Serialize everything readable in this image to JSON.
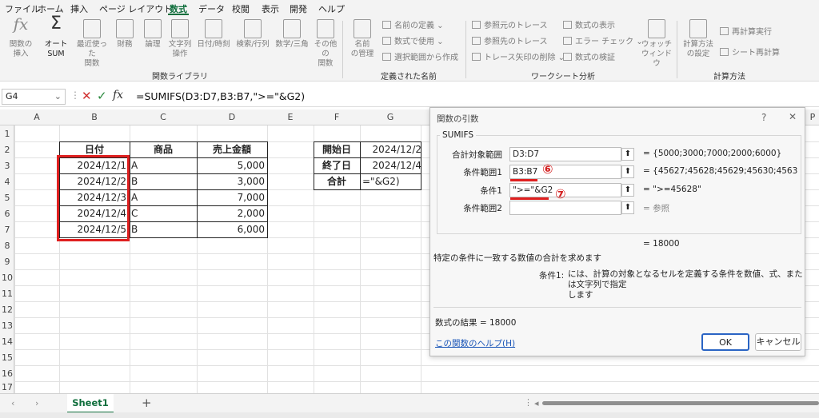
{
  "tabs": [
    "ファイル",
    "ホーム",
    "挿入",
    "ページ レイアウト",
    "数式",
    "データ",
    "校閲",
    "表示",
    "開発",
    "ヘルプ"
  ],
  "active_tab": "数式",
  "ribbon": {
    "fx_label": "関数の\n挿入",
    "autosum_label": "オート\nSUM",
    "recent_label": "最近使った\n関数",
    "finance_label": "財務",
    "logic_label": "論理",
    "text_label": "文字列\n操作",
    "datetime_label": "日付/時刻",
    "lookup_label": "検索/行列",
    "math_label": "数学/三角",
    "other_label": "その他の\n関数",
    "library_group": "関数ライブラリ",
    "name_mgr_label": "名前\nの管理",
    "define_name": "名前の定義",
    "use_in_formula": "数式で使用",
    "create_from_sel": "選択範囲から作成",
    "defined_names_group": "定義された名前",
    "trace_precedents": "参照元のトレース",
    "trace_dependents": "参照先のトレース",
    "remove_arrows": "トレース矢印の削除",
    "show_formulas": "数式の表示",
    "error_check": "エラー チェック",
    "evaluate_formula": "数式の検証",
    "watch_window": "ウォッチ\nウィンドウ",
    "auditing_group": "ワークシート分析",
    "calc_options": "計算方法\nの設定",
    "calc_now": "再計算実行",
    "calc_sheet": "シート再計算",
    "calc_group": "計算方法"
  },
  "formula_bar": {
    "name_box": "G4",
    "formula": "=SUMIFS(D3:D7,B3:B7,\">=\"&G2)"
  },
  "columns": [
    "A",
    "B",
    "C",
    "D",
    "E",
    "F",
    "G",
    "P"
  ],
  "rows": [
    "1",
    "2",
    "3",
    "4",
    "5",
    "6",
    "7",
    "8",
    "9",
    "10",
    "11",
    "12",
    "13",
    "14",
    "15",
    "16",
    "17"
  ],
  "table": {
    "headers": [
      "日付",
      "商品",
      "売上金額"
    ],
    "rows": [
      [
        "2024/12/1",
        "A",
        "5,000"
      ],
      [
        "2024/12/2",
        "B",
        "3,000"
      ],
      [
        "2024/12/3",
        "A",
        "7,000"
      ],
      [
        "2024/12/4",
        "C",
        "2,000"
      ],
      [
        "2024/12/5",
        "B",
        "6,000"
      ]
    ]
  },
  "side_table": {
    "start_label": "開始日",
    "start_value": "2024/12/2",
    "end_label": "終了日",
    "end_value": "2024/12/4",
    "total_label": "合計",
    "total_value": "=\"&G2)"
  },
  "dialog": {
    "title": "関数の引数",
    "help_q": "?",
    "close": "✕",
    "func_name": "SUMIFS",
    "arg1_label": "合計対象範囲",
    "arg1_value": "D3:D7",
    "arg1_result": "= {5000;3000;7000;2000;6000}",
    "arg2_label": "条件範囲1",
    "arg2_value": "B3:B7",
    "arg2_result": "= {45627;45628;45629;45630;4563",
    "arg3_label": "条件1",
    "arg3_value": "\">=\"&G2",
    "arg3_result": "= \">=45628\"",
    "arg4_label": "条件範囲2",
    "arg4_value": "",
    "arg4_result": "= 参照",
    "marker6": "⑥",
    "marker7": "⑦",
    "result_line": "=  18000",
    "description": "特定の条件に一致する数値の合計を求めます",
    "cond_label": "条件1:",
    "cond_help": "には、計算の対象となるセルを定義する条件を数値、式、または文字列で指定\nします",
    "formula_result": "数式の結果 =   18000",
    "help_link": "この関数のヘルプ(H)",
    "ok": "OK",
    "cancel": "キャンセル"
  },
  "sheet_tab": "Sheet1",
  "colors": {
    "excel_green": "#0f6e3c",
    "highlight_red": "#e02020"
  }
}
